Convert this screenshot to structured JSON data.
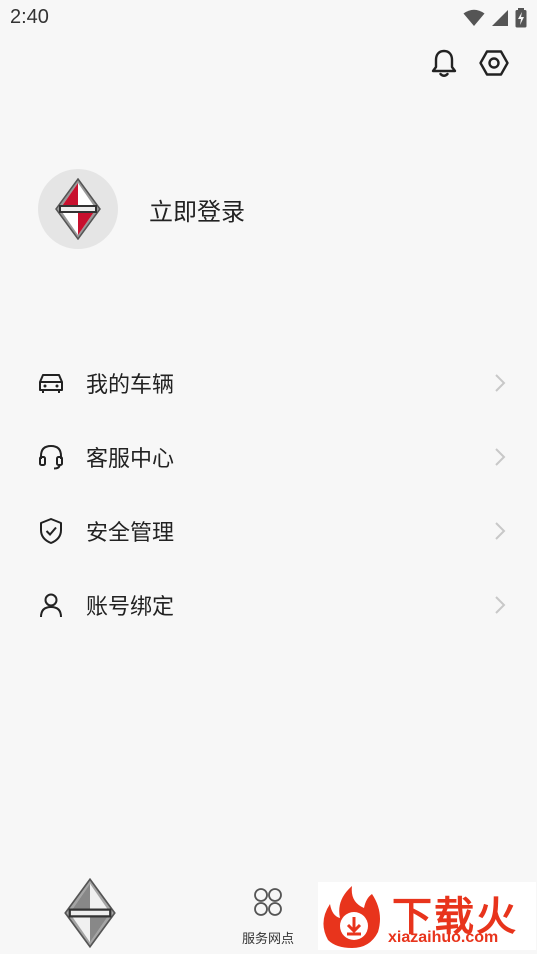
{
  "status_bar": {
    "time": "2:40"
  },
  "profile": {
    "login_label": "立即登录"
  },
  "menu": {
    "items": [
      {
        "label": "我的车辆",
        "icon": "car-icon"
      },
      {
        "label": "客服中心",
        "icon": "headset-icon"
      },
      {
        "label": "安全管理",
        "icon": "shield-check-icon"
      },
      {
        "label": "账号绑定",
        "icon": "user-icon"
      }
    ]
  },
  "bottom_nav": {
    "service_label": "服务网点"
  },
  "watermark": {
    "text": "下载火",
    "url": "xiazaihuo.com"
  },
  "colors": {
    "background": "#f7f7f7",
    "text": "#222222",
    "chevron": "#c8c8c8",
    "watermark": "#e8341c"
  }
}
